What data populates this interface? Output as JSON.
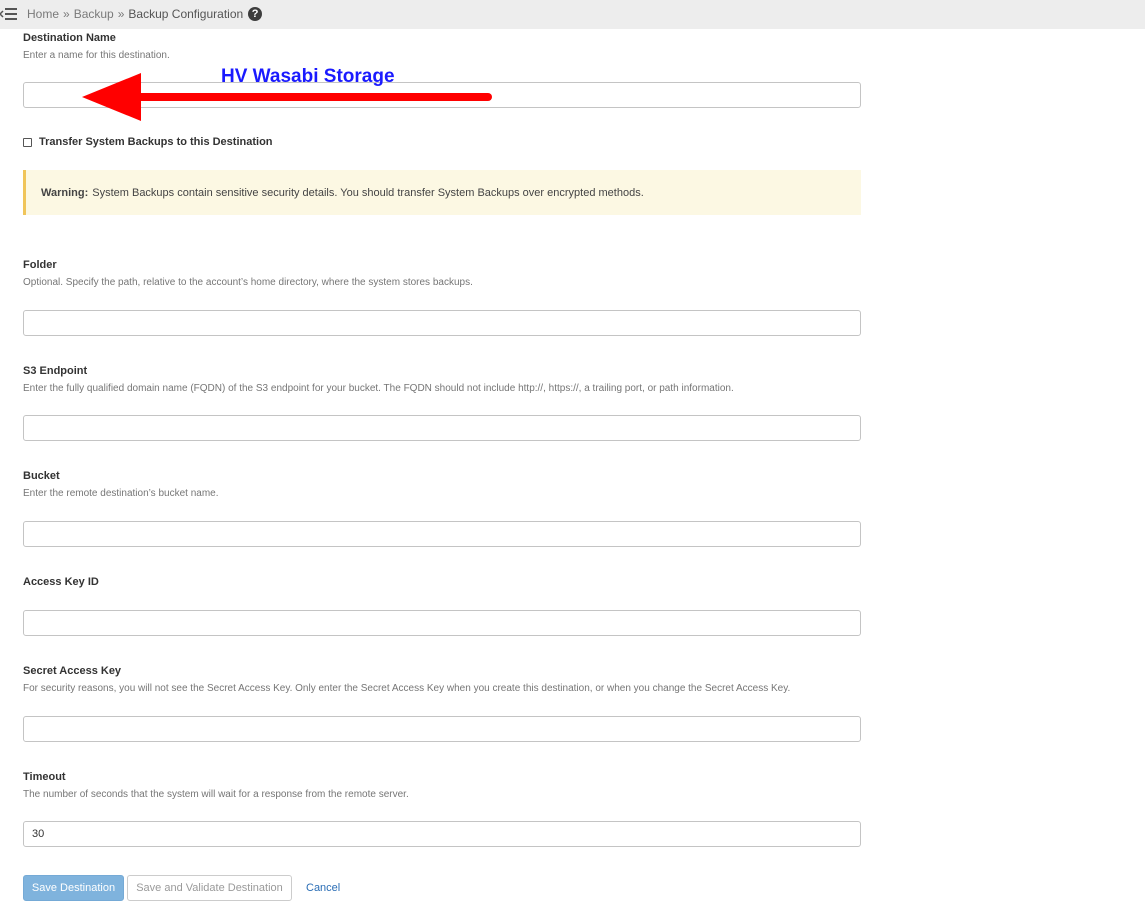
{
  "breadcrumb": {
    "home": "Home",
    "separator": "»",
    "backup": "Backup",
    "current": "Backup Configuration",
    "help_glyph": "?"
  },
  "annotation": {
    "text": "HV Wasabi Storage",
    "color": "#1a1aff",
    "arrow_color": "#ff0000"
  },
  "form": {
    "destination_name": {
      "label": "Destination Name",
      "help": "Enter a name for this destination.",
      "value": ""
    },
    "transfer_system_backups": {
      "label": "Transfer System Backups to this Destination",
      "checked": false
    },
    "warning": {
      "title": "Warning:",
      "text": "System Backups contain sensitive security details. You should transfer System Backups over encrypted methods."
    },
    "folder": {
      "label": "Folder",
      "help": "Optional. Specify the path, relative to the account’s home directory, where the system stores backups.",
      "value": ""
    },
    "s3_endpoint": {
      "label": "S3 Endpoint",
      "help": "Enter the fully qualified domain name (FQDN) of the S3 endpoint for your bucket. The FQDN should not include http://, https://, a trailing port, or path information.",
      "value": ""
    },
    "bucket": {
      "label": "Bucket",
      "help": "Enter the remote destination’s bucket name.",
      "value": ""
    },
    "access_key_id": {
      "label": "Access Key ID",
      "value": ""
    },
    "secret_access_key": {
      "label": "Secret Access Key",
      "help": "For security reasons, you will not see the Secret Access Key. Only enter the Secret Access Key when you create this destination, or when you change the Secret Access Key.",
      "value": ""
    },
    "timeout": {
      "label": "Timeout",
      "help": "The number of seconds that the system will wait for a response from the remote server.",
      "value": "30"
    }
  },
  "actions": {
    "save": "Save Destination",
    "save_validate": "Save and Validate Destination",
    "cancel": "Cancel"
  },
  "colors": {
    "primary_button": "#7fb3dd",
    "link": "#2a6db5",
    "warning_bg": "#fcf8e3",
    "warning_border": "#f0c55a"
  }
}
